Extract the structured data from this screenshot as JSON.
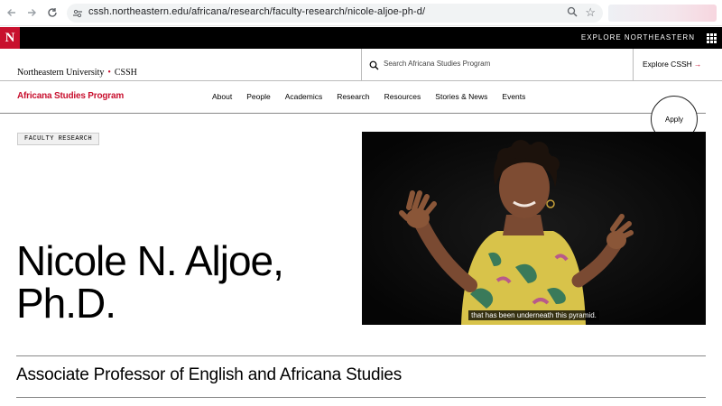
{
  "browser": {
    "url": "cssh.northeastern.edu/africana/research/faculty-research/nicole-aljoe-ph-d/"
  },
  "top_bar": {
    "logo_letter": "N",
    "explore_label": "EXPLORE NORTHEASTERN"
  },
  "header": {
    "university": "Northeastern University",
    "college": "CSSH",
    "search_placeholder": "Search Africana Studies Program",
    "explore_cssh": "Explore CSSH",
    "explore_arrow": "→"
  },
  "program": {
    "name": "Africana Studies Program"
  },
  "nav": {
    "items": [
      "About",
      "People",
      "Academics",
      "Research",
      "Resources",
      "Stories & News",
      "Events"
    ]
  },
  "apply_label": "Apply",
  "page": {
    "tag": "FACULTY RESEARCH",
    "name_line1": "Nicole N. Aljoe,",
    "name_line2": "Ph.D.",
    "job_title": "Associate Professor of English and Africana Studies"
  },
  "video": {
    "caption": "that has been underneath this pyramid."
  },
  "colors": {
    "brand_red": "#c8102e",
    "black": "#000000"
  }
}
